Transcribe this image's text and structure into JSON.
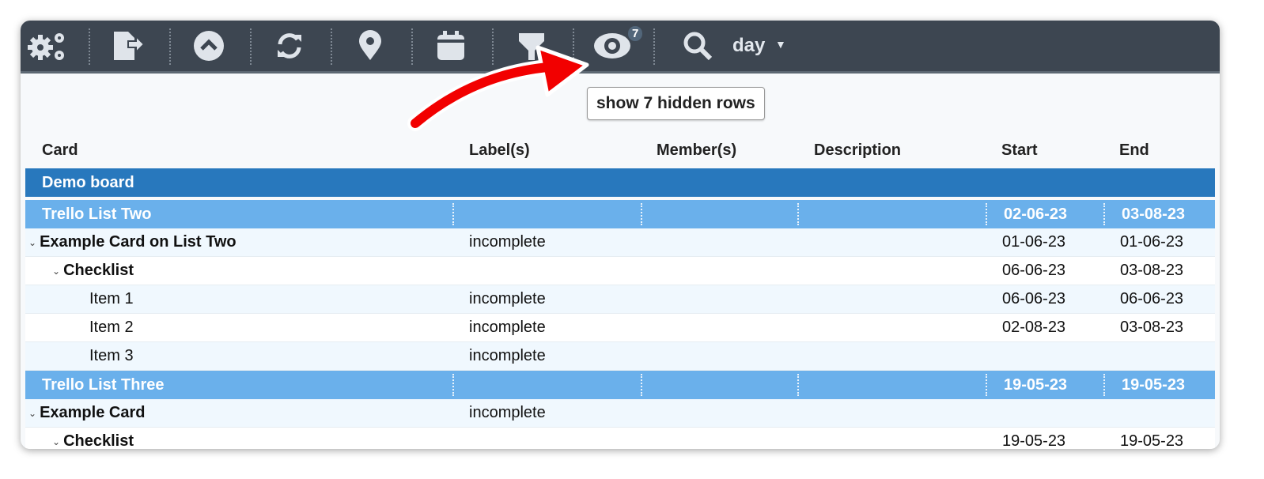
{
  "toolbar": {
    "buttons": [
      {
        "name": "settings-gears-icon"
      },
      {
        "name": "export-icon"
      },
      {
        "name": "collapse-up-icon"
      },
      {
        "name": "refresh-icon"
      },
      {
        "name": "location-pin-icon"
      },
      {
        "name": "calendar-icon"
      },
      {
        "name": "filter-icon"
      },
      {
        "name": "eye-icon"
      },
      {
        "name": "search-icon"
      }
    ],
    "hidden_count": "7",
    "scale_value": "day",
    "tooltip": "show 7 hidden rows"
  },
  "colors": {
    "toolbar": "#3d4651",
    "group": "#2878bd",
    "list": "#6ab0eb",
    "arrow": "#f20000"
  },
  "columns": [
    "Card",
    "Label(s)",
    "Member(s)",
    "Description",
    "Start",
    "End"
  ],
  "rows": [
    {
      "type": "group",
      "card": "Demo board"
    },
    {
      "type": "list",
      "card": "Trello List Two",
      "start": "02-06-23",
      "end": "03-08-23"
    },
    {
      "type": "card",
      "card": "Example Card on List Two",
      "label": "incomplete",
      "start": "01-06-23",
      "end": "01-06-23"
    },
    {
      "type": "checklist",
      "card": "Checklist",
      "start": "06-06-23",
      "end": "03-08-23"
    },
    {
      "type": "item",
      "card": "Item 1",
      "label": "incomplete",
      "start": "06-06-23",
      "end": "06-06-23"
    },
    {
      "type": "item",
      "card": "Item 2",
      "label": "incomplete",
      "start": "02-08-23",
      "end": "03-08-23"
    },
    {
      "type": "item",
      "card": "Item 3",
      "label": "incomplete"
    },
    {
      "type": "list",
      "card": "Trello List Three",
      "start": "19-05-23",
      "end": "19-05-23"
    },
    {
      "type": "card",
      "card": "Example Card",
      "label": "incomplete"
    },
    {
      "type": "checklist",
      "card": "Checklist",
      "start": "19-05-23",
      "end": "19-05-23"
    }
  ]
}
